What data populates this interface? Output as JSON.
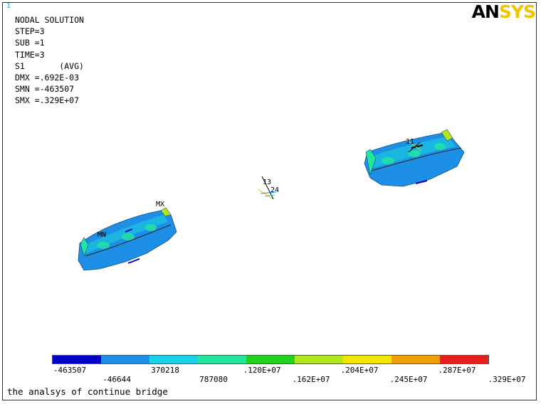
{
  "window_number": "1",
  "logo": {
    "part1": "AN",
    "part2": "SYS"
  },
  "info": {
    "title": "NODAL SOLUTION",
    "lines": [
      "STEP=3",
      "SUB =1",
      "TIME=3",
      "S1       (AVG)",
      "DMX =.692E-03",
      "SMN =-463507",
      "SMX =.329E+07"
    ]
  },
  "markers": {
    "mx": "MX",
    "mn": "MN",
    "n11": "11",
    "n13": "13",
    "n24": "24"
  },
  "legend": {
    "colors": [
      "#0000c8",
      "#1e8fe6",
      "#19d2e6",
      "#23e6a0",
      "#1ed21e",
      "#b4e61e",
      "#f0e600",
      "#f0a000",
      "#e61e1e"
    ],
    "labels_top": [
      "-463507",
      "370218",
      ".120E+07",
      ".204E+07",
      ".287E+07"
    ],
    "labels_bottom": [
      "-46644",
      "787080",
      ".162E+07",
      ".245E+07",
      ".329E+07"
    ]
  },
  "caption": "the analsys of continue bridge"
}
